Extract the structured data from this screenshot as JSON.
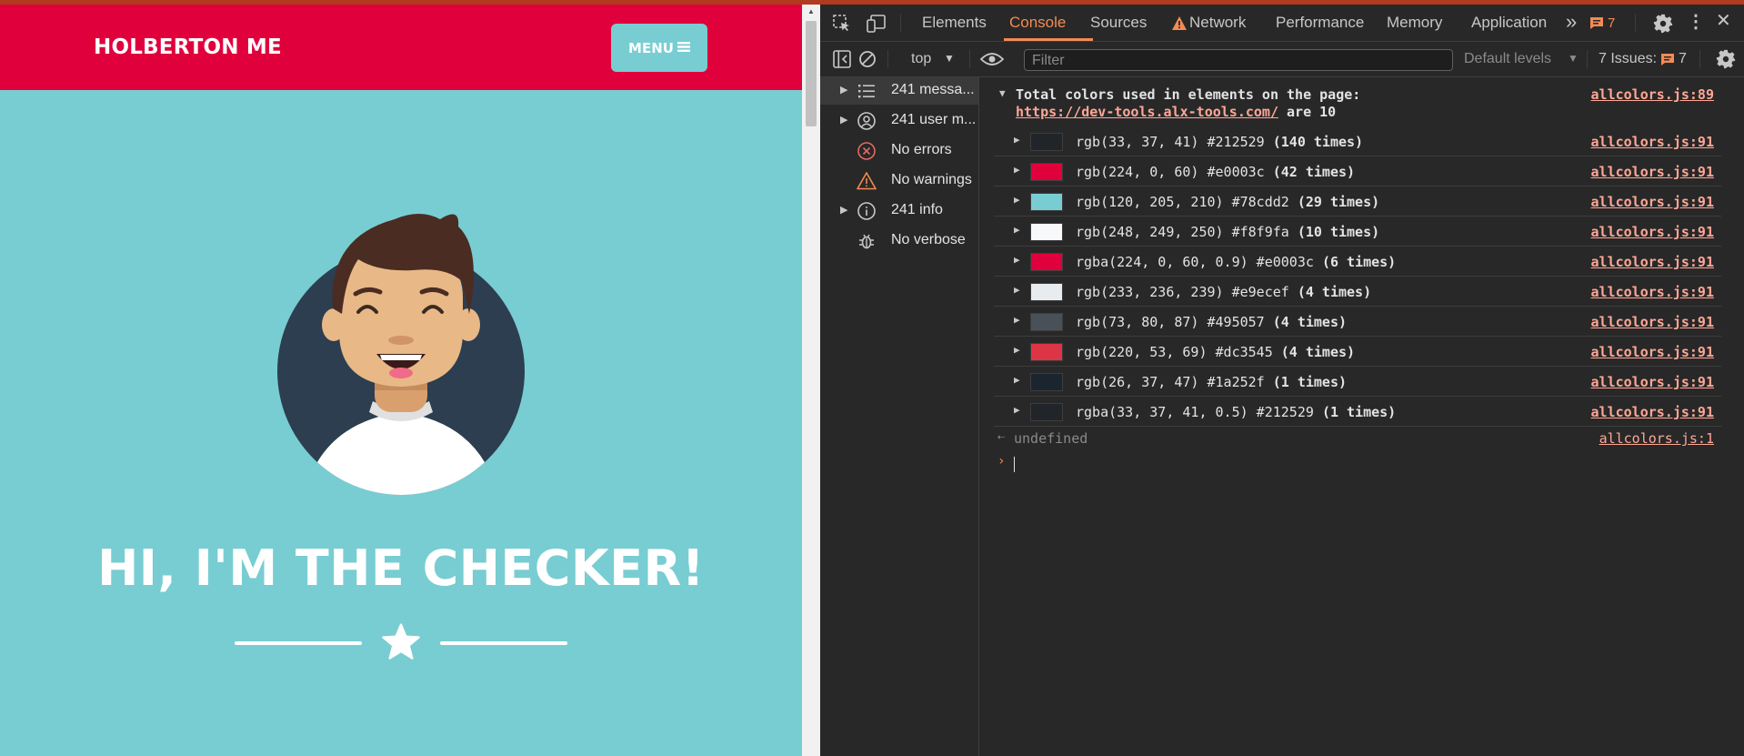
{
  "page": {
    "brand": "HOLBERTON ME",
    "menu_label": "MENU",
    "headline": "HI, I'M THE CHECKER!"
  },
  "devtools": {
    "tabs": [
      "Elements",
      "Console",
      "Sources",
      "Network",
      "Performance",
      "Memory",
      "Application"
    ],
    "active_tab": "Console",
    "more_tabs": "»",
    "issues_badge": "7",
    "context": "top",
    "filter_placeholder": "Filter",
    "levels": "Default levels",
    "issues_label": "7 Issues:",
    "issues_count": "7",
    "sidebar": [
      {
        "label": "241 messa...",
        "icon": "list-icon",
        "expandable": true
      },
      {
        "label": "241 user m...",
        "icon": "user-icon",
        "expandable": true
      },
      {
        "label": "No errors",
        "icon": "error-icon",
        "expandable": false
      },
      {
        "label": "No warnings",
        "icon": "warning-icon",
        "expandable": false
      },
      {
        "label": "241 info",
        "icon": "info-icon",
        "expandable": true
      },
      {
        "label": "No verbose",
        "icon": "bug-icon",
        "expandable": false
      }
    ],
    "console": {
      "header_text": "Total colors used in elements on the page:",
      "header_url": "https://dev-tools.alx-tools.com/",
      "header_tail": "are 10",
      "header_source": "allcolors.js:89",
      "colors": [
        {
          "text": "rgb(33, 37, 41) #212529",
          "count": "(140 times)",
          "hex": "#212529",
          "source": "allcolors.js:91"
        },
        {
          "text": "rgb(224, 0, 60) #e0003c",
          "count": "(42 times)",
          "hex": "#e0003c",
          "source": "allcolors.js:91"
        },
        {
          "text": "rgb(120, 205, 210) #78cdd2",
          "count": "(29 times)",
          "hex": "#78cdd2",
          "source": "allcolors.js:91"
        },
        {
          "text": "rgb(248, 249, 250) #f8f9fa",
          "count": "(10 times)",
          "hex": "#f8f9fa",
          "source": "allcolors.js:91"
        },
        {
          "text": "rgba(224, 0, 60, 0.9) #e0003c",
          "count": "(6 times)",
          "hex": "#e0003c",
          "source": "allcolors.js:91"
        },
        {
          "text": "rgb(233, 236, 239) #e9ecef",
          "count": "(4 times)",
          "hex": "#e9ecef",
          "source": "allcolors.js:91"
        },
        {
          "text": "rgb(73, 80, 87) #495057",
          "count": "(4 times)",
          "hex": "#495057",
          "source": "allcolors.js:91"
        },
        {
          "text": "rgb(220, 53, 69) #dc3545",
          "count": "(4 times)",
          "hex": "#dc3545",
          "source": "allcolors.js:91"
        },
        {
          "text": "rgb(26, 37, 47) #1a252f",
          "count": "(1 times)",
          "hex": "#1a252f",
          "source": "allcolors.js:91"
        },
        {
          "text": "rgba(33, 37, 41, 0.5) #212529",
          "count": "(1 times)",
          "hex": "#212529",
          "source": "allcolors.js:91"
        }
      ],
      "result_text": "undefined",
      "result_source": "allcolors.js:1"
    }
  }
}
